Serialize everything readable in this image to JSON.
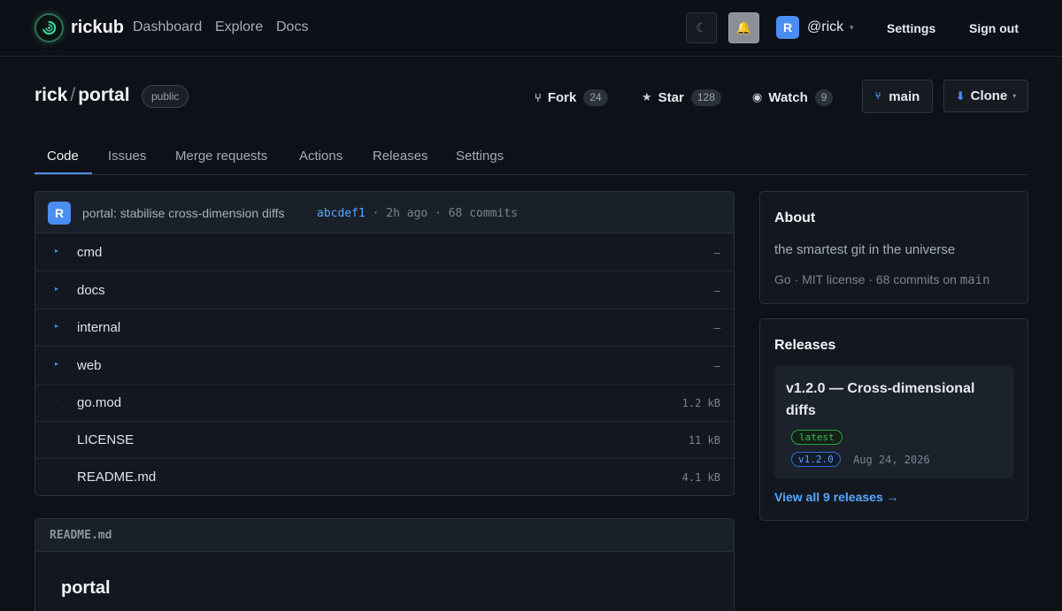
{
  "colors": {
    "background": "#0e1117",
    "accent": "#4b8ef2",
    "link": "#58a6ff",
    "success": "#3fb950"
  },
  "nav": {
    "brand": "rickub",
    "links": [
      "Dashboard",
      "Explore",
      "Docs"
    ],
    "theme_icon": "moon-icon",
    "bell_icon": "bell-icon",
    "user_avatar": "R",
    "username": "@rick",
    "user_caret": "▾",
    "settings": "Settings",
    "sign_out": "Sign out"
  },
  "repo": {
    "owner": "rick",
    "separator": "/",
    "name": "portal",
    "visibility": "public",
    "fork_label": "Fork",
    "fork_count": "24",
    "star_label": "Star",
    "star_count": "128",
    "watch_label": "Watch",
    "watch_count": "9",
    "branch": "main",
    "clone_label": "Clone"
  },
  "tabs": [
    {
      "label": "Code",
      "active": true
    },
    {
      "label": "Issues",
      "active": false
    },
    {
      "label": "Merge requests",
      "active": false
    },
    {
      "label": "Actions",
      "active": false
    },
    {
      "label": "Releases",
      "active": false
    },
    {
      "label": "Settings",
      "active": false
    }
  ],
  "commit": {
    "avatar": "R",
    "message": "portal: stabilise cross-dimension diffs",
    "sha": "abcdef1",
    "time": "2h ago",
    "commits": "68 commits",
    "sep": "·"
  },
  "files": [
    {
      "name": "cmd",
      "type": "dir",
      "size": "–"
    },
    {
      "name": "docs",
      "type": "dir",
      "size": "–"
    },
    {
      "name": "internal",
      "type": "dir",
      "size": "–"
    },
    {
      "name": "web",
      "type": "dir",
      "size": "–"
    },
    {
      "name": "go.mod",
      "type": "file",
      "size": "1.2 kB"
    },
    {
      "name": "LICENSE",
      "type": "file",
      "size": "11 kB"
    },
    {
      "name": "README.md",
      "type": "file",
      "size": "4.1 kB"
    }
  ],
  "readme": {
    "filename": "README.md",
    "heading": "portal"
  },
  "about": {
    "title": "About",
    "description": "the smartest git in the universe",
    "meta_prefix": "Go · MIT license · 68 commits on ",
    "meta_branch": "main"
  },
  "releases": {
    "title": "Releases",
    "latest_title": "v1.2.0 — Cross-dimensional diffs",
    "latest_tag": "latest",
    "version": "v1.2.0",
    "date": "Aug 24, 2026",
    "view_all": "View all 9 releases →"
  }
}
